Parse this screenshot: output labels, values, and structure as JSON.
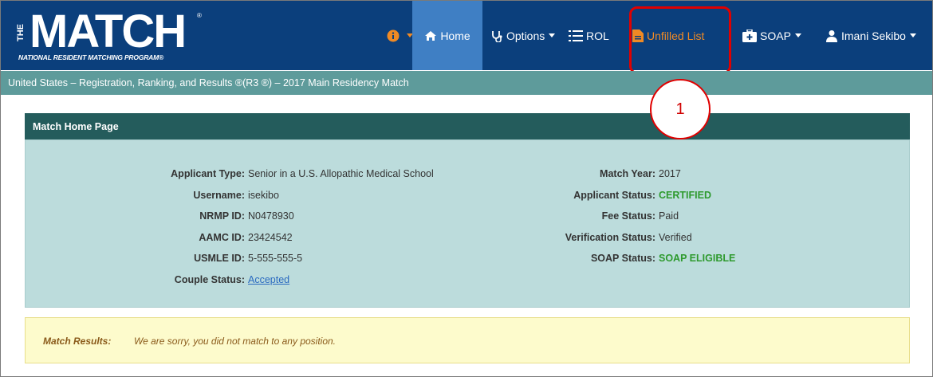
{
  "brand": {
    "logo_the": "THE",
    "logo_word": "MATCH",
    "logo_reg": "®",
    "logo_subtitle": "NATIONAL RESIDENT MATCHING PROGRAM®"
  },
  "nav": {
    "home": "Home",
    "options": "Options",
    "rol": "ROL",
    "unfilled": "Unfilled List",
    "soap": "SOAP",
    "user": "Imani Sekibo"
  },
  "breadcrumb": "United States  –  Registration, Ranking, and Results ®(R3 ®)  –  2017 Main Residency Match",
  "callout": "1",
  "panel": {
    "title": "Match Home Page",
    "left": [
      {
        "label": "Applicant Type:",
        "value": "Senior in a U.S. Allopathic Medical School"
      },
      {
        "label": "Username:",
        "value": "isekibo"
      },
      {
        "label": "NRMP ID:",
        "value": "N0478930"
      },
      {
        "label": "AAMC ID:",
        "value": "23424542"
      },
      {
        "label": "USMLE ID:",
        "value": "5-555-555-5"
      },
      {
        "label": "Couple Status:",
        "value": "Accepted"
      }
    ],
    "right": [
      {
        "label": "Match Year:",
        "value": "2017"
      },
      {
        "label": "Applicant Status:",
        "value": "CERTIFIED"
      },
      {
        "label": "Fee Status:",
        "value": "Paid"
      },
      {
        "label": "Verification Status:",
        "value": "Verified"
      },
      {
        "label": "SOAP Status:",
        "value": "SOAP ELIGIBLE"
      }
    ]
  },
  "alert": {
    "label": "Match Results:",
    "message": "We are sorry, you did not match to any position."
  },
  "colors": {
    "navbar": "#0b3f7c",
    "active_tab": "#3f7fc4",
    "accent_orange": "#f08a24",
    "breadcrumb_bar": "#5e9b9b",
    "panel_header": "#245c5c",
    "panel_body": "#bcdcdc",
    "status_green": "#2e9a2e",
    "highlight_red": "#e00000"
  },
  "icons": {
    "info": "info-circle-icon",
    "home": "home-icon",
    "options": "stethoscope-icon",
    "rol": "list-icon",
    "unfilled": "document-icon",
    "soap": "medkit-icon",
    "user": "user-icon"
  }
}
